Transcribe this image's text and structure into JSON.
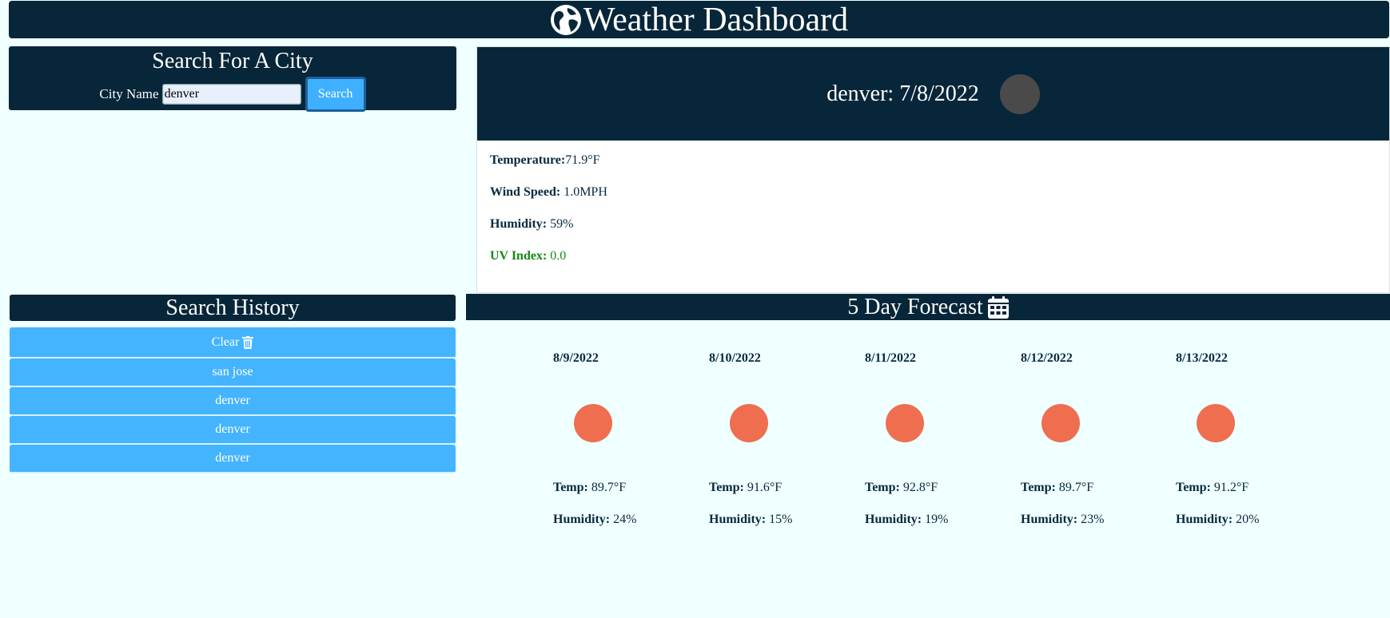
{
  "header": {
    "title": "Weather Dashboard",
    "icon": "globe-icon"
  },
  "search": {
    "title": "Search For A City",
    "label": "City Name",
    "value": "denver",
    "button": "Search"
  },
  "current": {
    "heading": "denver: 7/8/2022",
    "temp_label": "Temperature:",
    "temp_value": "71.9°F",
    "wind_label": "Wind Speed:",
    "wind_value": " 1.0MPH",
    "humidity_label": "Humidity:",
    "humidity_value": " 59%",
    "uv_label": "UV Index:",
    "uv_value": " 0.0",
    "uv_color": "#138a13"
  },
  "history": {
    "title": "Search History",
    "clear_label": "Clear",
    "items": [
      "san jose",
      "denver",
      "denver",
      "denver"
    ]
  },
  "forecast": {
    "title": "5 Day Forecast",
    "temp_label": "Temp:",
    "humidity_label": "Humidity:",
    "days": [
      {
        "date": "8/9/2022",
        "temp": "89.7°F",
        "humidity": "24%"
      },
      {
        "date": "8/10/2022",
        "temp": "91.6°F",
        "humidity": "15%"
      },
      {
        "date": "8/11/2022",
        "temp": "92.8°F",
        "humidity": "19%"
      },
      {
        "date": "8/12/2022",
        "temp": "89.7°F",
        "humidity": "23%"
      },
      {
        "date": "8/13/2022",
        "temp": "91.2°F",
        "humidity": "20%"
      }
    ]
  },
  "colors": {
    "navy": "#072639",
    "background": "#f0ffff",
    "button_blue": "#44b4ff",
    "sun": "#ee6e4f"
  }
}
